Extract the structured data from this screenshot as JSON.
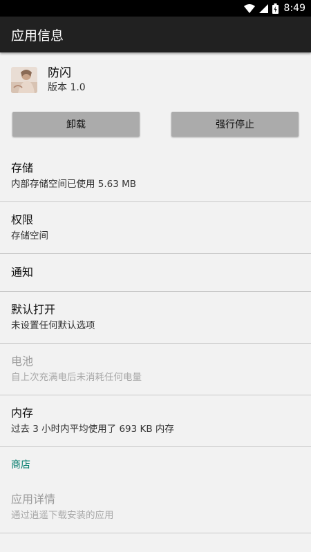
{
  "status_bar": {
    "time": "8:49",
    "icons": [
      "wifi-icon",
      "cell-signal-icon",
      "battery-icon"
    ]
  },
  "app_bar": {
    "title": "应用信息"
  },
  "app": {
    "name": "防闪",
    "version": "版本 1.0",
    "icon": "app-icon-thumbnail"
  },
  "buttons": {
    "uninstall": "卸载",
    "force_stop": "强行停止"
  },
  "items": [
    {
      "title": "存储",
      "subtitle": "内部存储空间已使用 5.63 MB",
      "enabled": true
    },
    {
      "title": "权限",
      "subtitle": "存储空间",
      "enabled": true
    },
    {
      "title": "通知",
      "enabled": true
    },
    {
      "title": "默认打开",
      "subtitle": "未设置任何默认选项",
      "enabled": true
    },
    {
      "title": "电池",
      "subtitle": "自上次充满电后未消耗任何电量",
      "enabled": false
    },
    {
      "title": "内存",
      "subtitle": "过去 3 小时内平均使用了 693 KB 内存",
      "enabled": true
    }
  ],
  "store": {
    "category": "商店",
    "title": "应用详情",
    "subtitle": "通过逍遥下载安装的应用"
  },
  "colors": {
    "accent": "#00796b",
    "app_bar": "#212121",
    "background": "#f2f2f2"
  }
}
